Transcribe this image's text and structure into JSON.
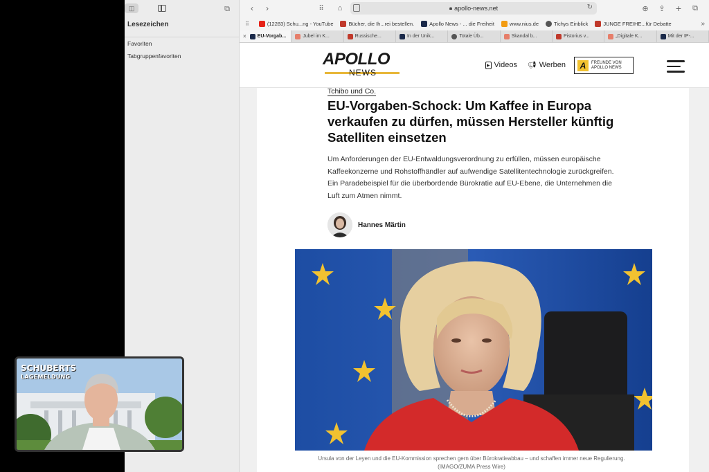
{
  "sidebar": {
    "title": "Lesezeichen",
    "items": [
      "Favoriten",
      "Tabgruppenfavoriten"
    ]
  },
  "browser": {
    "url": "apollo-news.net",
    "bookmarks": [
      {
        "label": "(12283) Schu...ng - YouTube",
        "color": "#e62117"
      },
      {
        "label": "Bücher, die Ih...rei bestellen.",
        "color": "#c0392b"
      },
      {
        "label": "Apollo News - ... die Freiheit",
        "color": "#1b2a4a"
      },
      {
        "label": "www.nius.de",
        "color": "#f39c12"
      },
      {
        "label": "Tichys Einblick",
        "color": "#555555"
      },
      {
        "label": "JUNGE FREIHE...für Debatte",
        "color": "#c0392b"
      }
    ],
    "tabs": [
      {
        "label": "EU-Vorgab...",
        "color": "#1b2a4a",
        "active": true
      },
      {
        "label": "Jubel im K...",
        "color": "#e67e6a"
      },
      {
        "label": "Russische...",
        "color": "#c0392b"
      },
      {
        "label": "In der Unik...",
        "color": "#1b2a4a"
      },
      {
        "label": "Totale Üb...",
        "color": "#555555"
      },
      {
        "label": "Skandal b...",
        "color": "#e67e6a"
      },
      {
        "label": "Pistorius v...",
        "color": "#c0392b"
      },
      {
        "label": "„Digitale K...",
        "color": "#e67e6a"
      },
      {
        "label": "Mit der IP-...",
        "color": "#1b2a4a"
      }
    ]
  },
  "site": {
    "logo_top": "APOLLO",
    "logo_bottom": "NEWS",
    "nav_videos": "Videos",
    "nav_werben": "Werben",
    "freunde_line1": "FREUNDE VON",
    "freunde_line2": "APOLLO NEWS"
  },
  "article": {
    "kicker": "Tchibo und Co.",
    "headline": "EU-Vorgaben-Schock: Um Kaffee in Europa verkaufen zu dürfen, müssen Hersteller künftig Satelliten einsetzen",
    "lede": "Um Anforderungen der EU-Entwaldungsverordnung zu erfüllen, müssen europäische Kaffeekonzerne und Rohstoffhändler auf aufwendige Satellitentechnologie zurückgreifen. Ein Paradebeispiel für die überbordende Bürokratie auf EU-Ebene, die Unternehmen die Luft zum Atmen nimmt.",
    "author": "Hannes Märtin",
    "caption": "Ursula von der Leyen und die EU-Kommission sprechen gern über Bürokratieabbau – und schaffen immer neue Regulierung.",
    "credit": "(IMAGO/ZUMA Press Wire)"
  },
  "pip": {
    "title": "SCHUBERTS",
    "subtitle": "LAGEMELDUNG"
  },
  "colors": {
    "accent": "#e8b73a",
    "eu_blue": "#1f4fa8",
    "eu_star": "#f2c230"
  }
}
